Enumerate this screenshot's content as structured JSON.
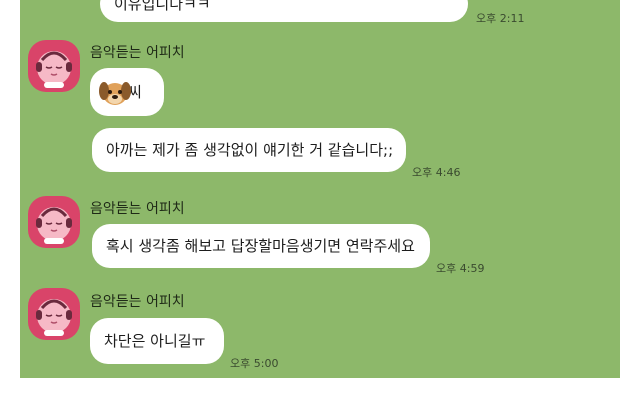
{
  "messages": {
    "m0": {
      "text": "이유입니다ㅋㅋ",
      "time": "오후 2:11"
    },
    "g1": {
      "sender": "음악듣는 어피치",
      "m1_text": "씨",
      "m2_text": "아까는 제가 좀 생각없이 얘기한 거 같습니다;;",
      "m2_time": "오후 4:46"
    },
    "g2": {
      "sender": "음악듣는 어피치",
      "m3_text": "혹시 생각좀 해보고 답장할마음생기면 연락주세요",
      "m3_time": "오후 4:59"
    },
    "g3": {
      "sender": "음악듣는 어피치",
      "m4_text": "차단은 아니길ㅠ",
      "m4_time": "오후 5:00"
    }
  },
  "colors": {
    "chat_background": "#8db86a",
    "bubble": "#ffffff",
    "avatar": "#d94469"
  },
  "icons": {
    "avatar": "apeach-headphones-icon",
    "emoji": "dog-face-emoji"
  }
}
